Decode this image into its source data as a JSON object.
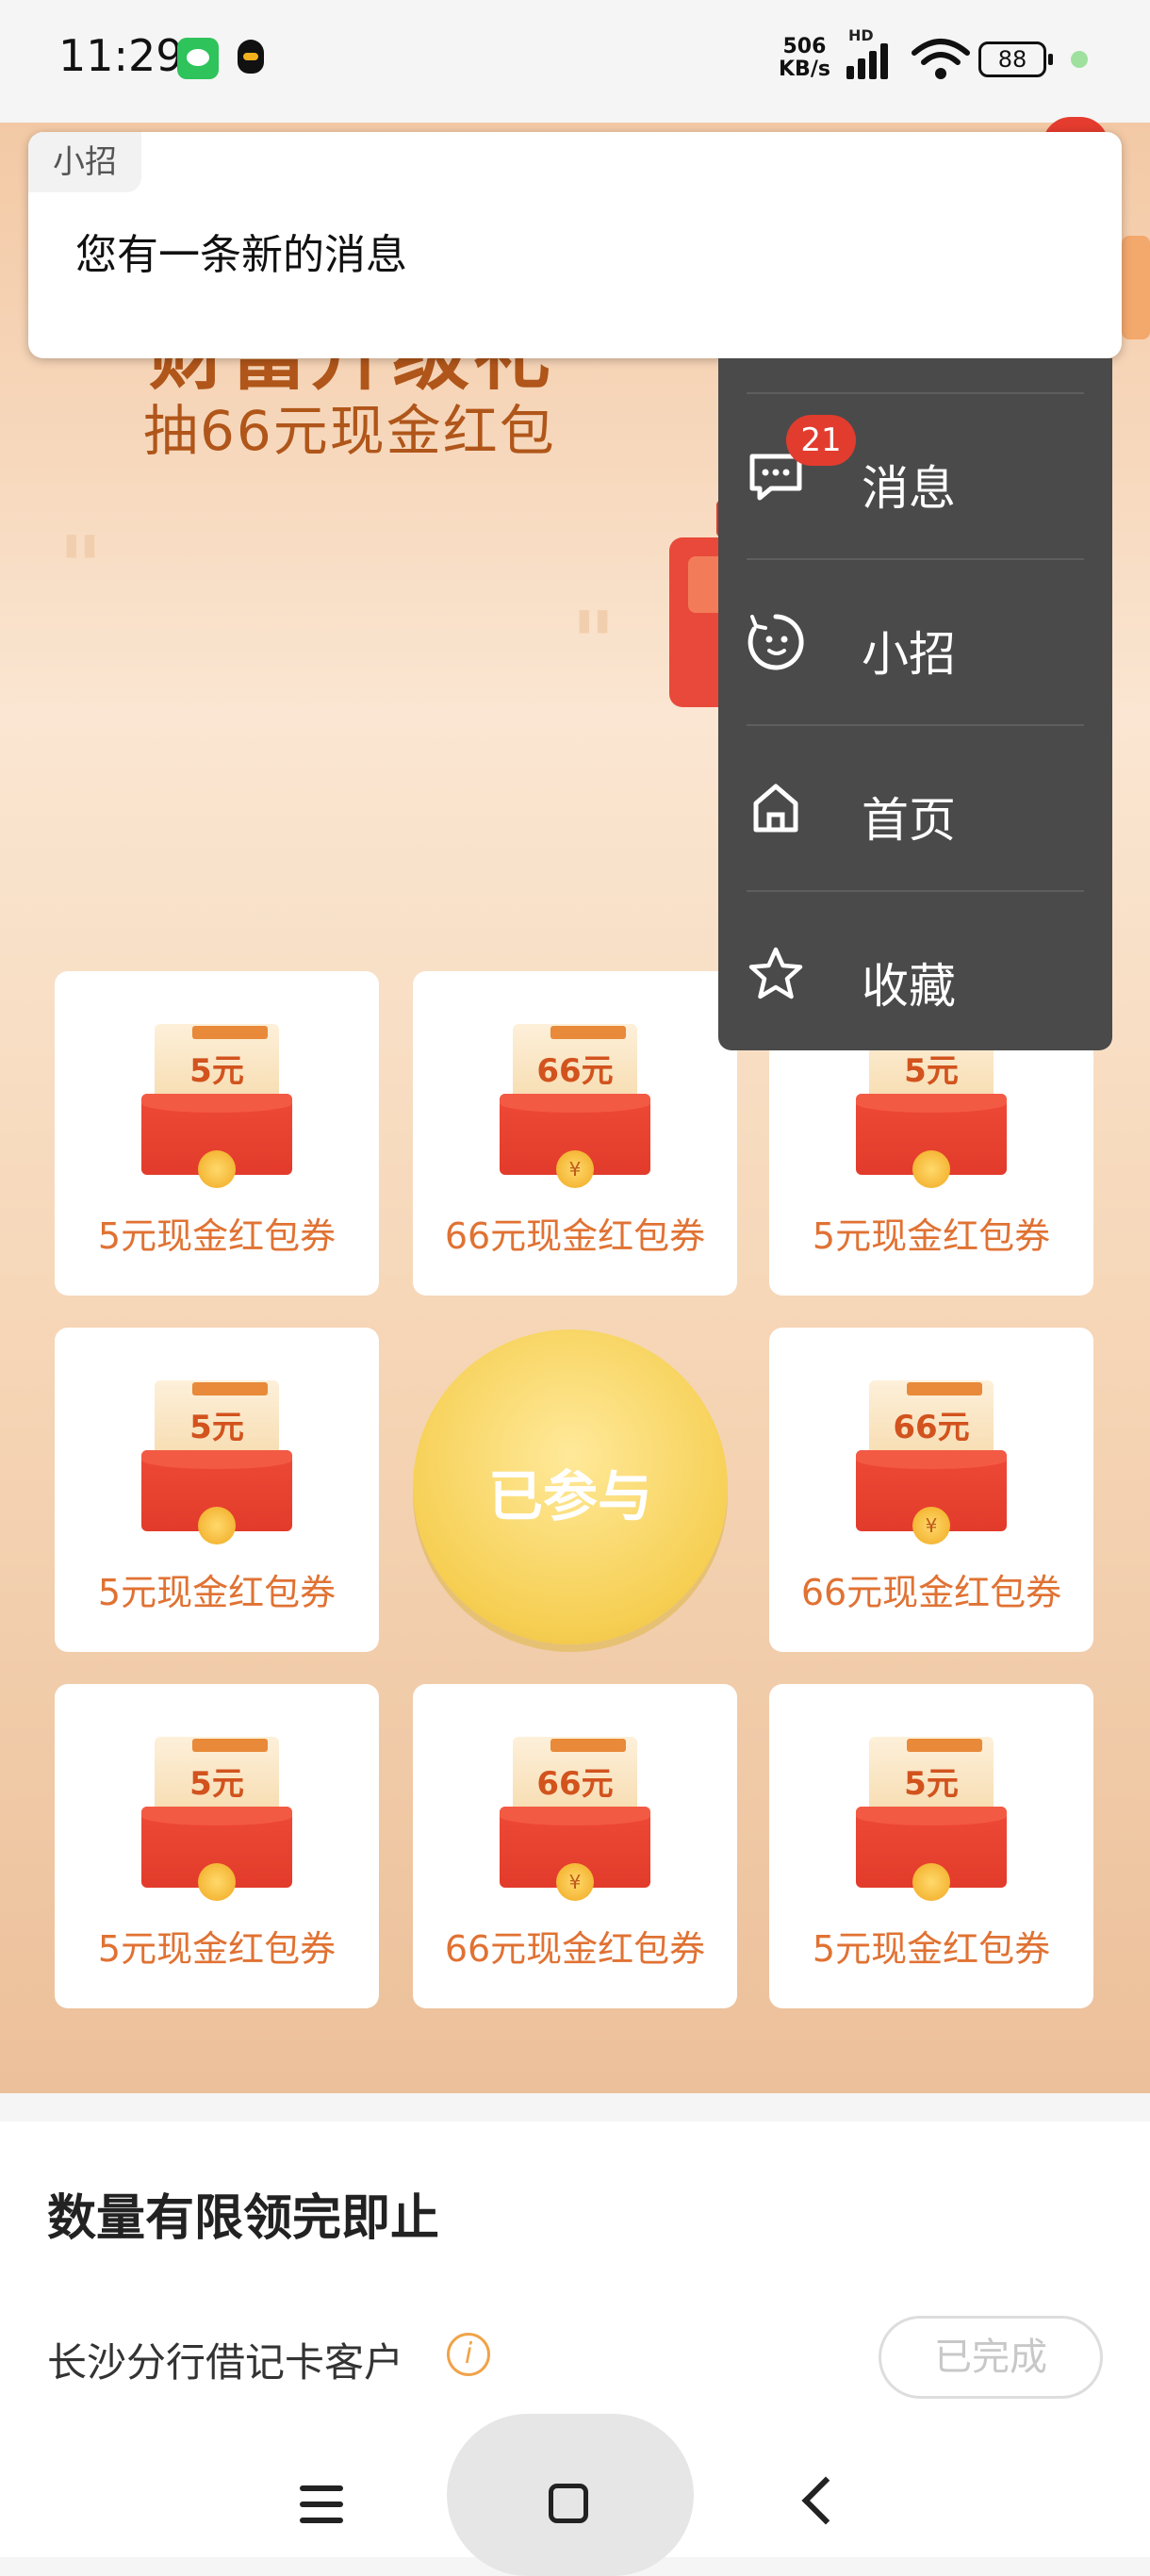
{
  "status_bar": {
    "time": "11:29",
    "net_speed_value": "506",
    "net_speed_unit": "KB/s",
    "network_type": "HD",
    "battery": "88",
    "icons": [
      "wechat-icon",
      "qq-icon",
      "signal-icon",
      "wifi-icon",
      "battery-icon"
    ]
  },
  "hero": {
    "title": "财富升级礼",
    "subtitle": "抽66元现金红包"
  },
  "grid": {
    "cells": [
      {
        "amount": "5元",
        "label": "5元现金红包券"
      },
      {
        "amount": "66元",
        "label": "66元现金红包券"
      },
      {
        "amount": "5元",
        "label": "5元现金红包券"
      },
      {
        "amount": "5元",
        "label": "5元现金红包券"
      },
      {
        "amount": "66元",
        "label": "66元现金红包券"
      },
      {
        "amount": "5元",
        "label": "5元现金红包券"
      },
      {
        "amount": "66元",
        "label": "66元现金红包券"
      },
      {
        "amount": "5元",
        "label": "5元现金红包券"
      }
    ],
    "center_button": "已参与"
  },
  "info": {
    "title": "数量有限领完即止",
    "customer_text": "长沙分行借记卡客户",
    "info_icon": "i",
    "status_button": "已完成"
  },
  "notification": {
    "app_name": "小招",
    "message": "您有一条新的消息"
  },
  "popup_menu": {
    "items": [
      {
        "label": "消息",
        "icon": "message-icon",
        "badge": "21"
      },
      {
        "label": "小招",
        "icon": "assistant-icon"
      },
      {
        "label": "首页",
        "icon": "home-icon"
      },
      {
        "label": "收藏",
        "icon": "star-icon"
      }
    ]
  },
  "nav_bar": {
    "icons": [
      "menu-icon",
      "home-square-icon",
      "back-icon"
    ]
  },
  "colors": {
    "accent_orange": "#e07233",
    "title_brown": "#b0561a",
    "menu_bg": "#4a4a4a",
    "badge_red": "#e23c2f"
  }
}
